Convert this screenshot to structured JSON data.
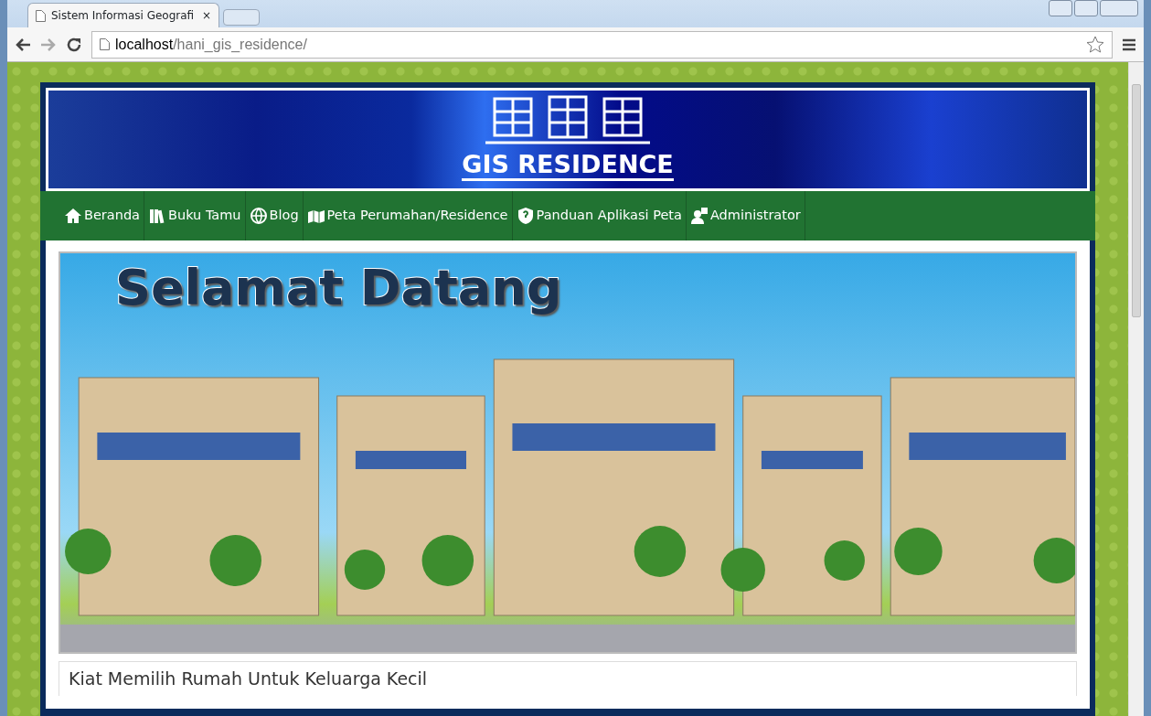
{
  "browser": {
    "tab_title": "Sistem Informasi Geografi",
    "tab_close": "×",
    "url_host": "localhost",
    "url_path": "/hani_gis_residence/"
  },
  "banner": {
    "title": "GIS RESIDENCE"
  },
  "nav": [
    {
      "label": "Beranda",
      "kind": "home"
    },
    {
      "label": "Buku Tamu",
      "kind": "books"
    },
    {
      "label": "Blog",
      "kind": "globe"
    },
    {
      "label": "Peta Perumahan/Residence",
      "kind": "map"
    },
    {
      "label": "Panduan Aplikasi Peta",
      "kind": "shield"
    },
    {
      "label": "Administrator",
      "kind": "user"
    }
  ],
  "hero": {
    "heading": "Selamat Datang"
  },
  "article": {
    "title": "Kiat Memilih Rumah Untuk Keluarga Kecil"
  }
}
